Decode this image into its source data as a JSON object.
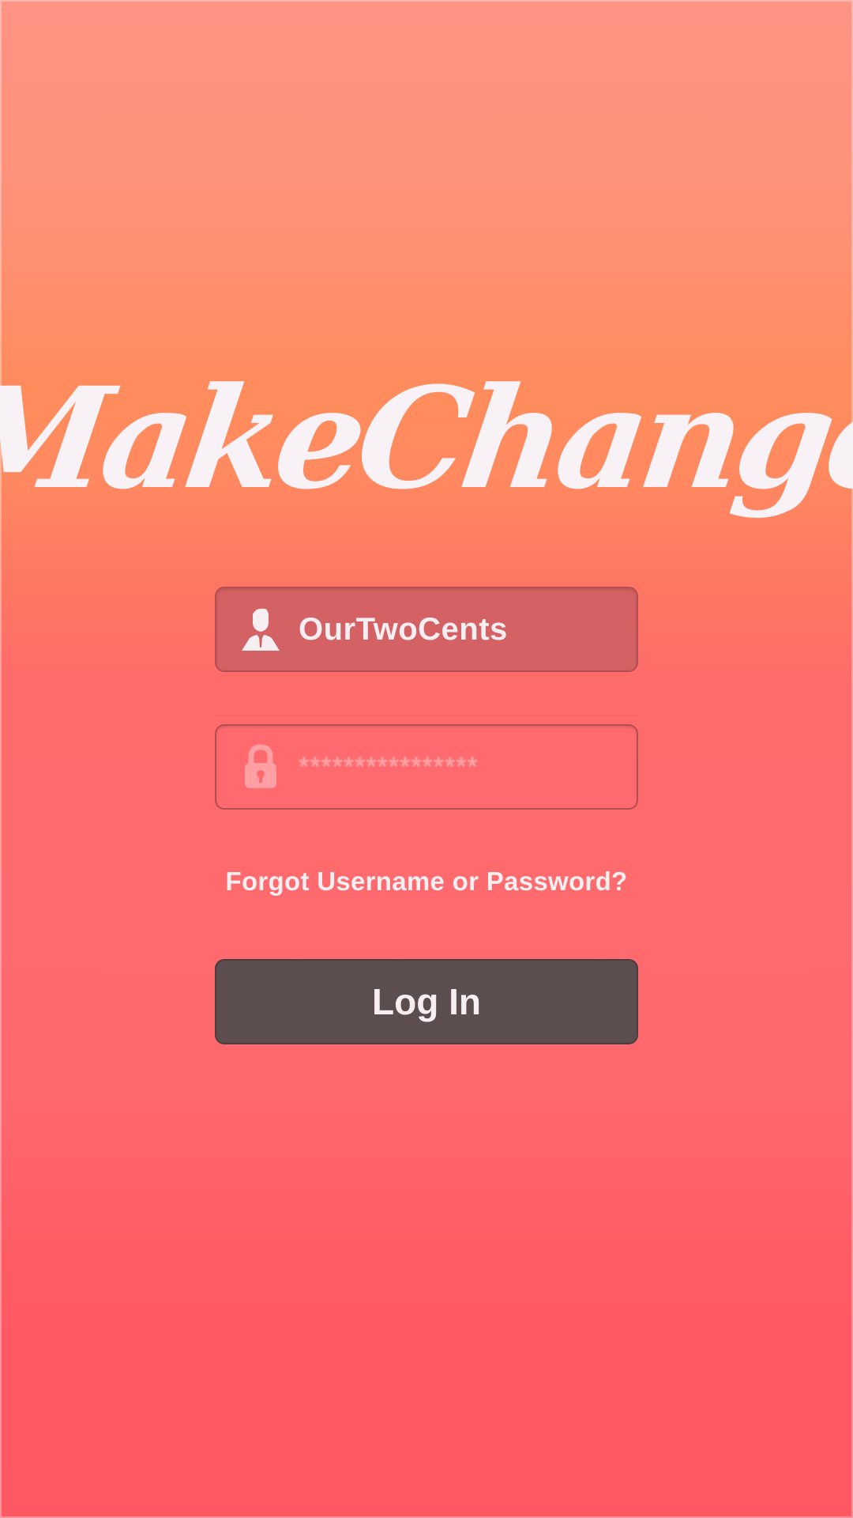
{
  "app": {
    "logo_text": "MakeChange"
  },
  "login_form": {
    "username": {
      "value": "OurTwoCents",
      "icon": "user-icon"
    },
    "password": {
      "masked_value": "****************",
      "icon": "lock-icon"
    },
    "forgot_link": "Forgot Username or Password?",
    "login_button": "Log In"
  },
  "colors": {
    "gradient_top": "#ff9384",
    "gradient_mid": "#ff8c5c",
    "gradient_bottom": "#ff5863",
    "username_field_bg": "#d46163",
    "password_field_bg": "#ff6a6e",
    "login_button_bg": "#5c4d4f",
    "text_light": "#f7eef2"
  }
}
